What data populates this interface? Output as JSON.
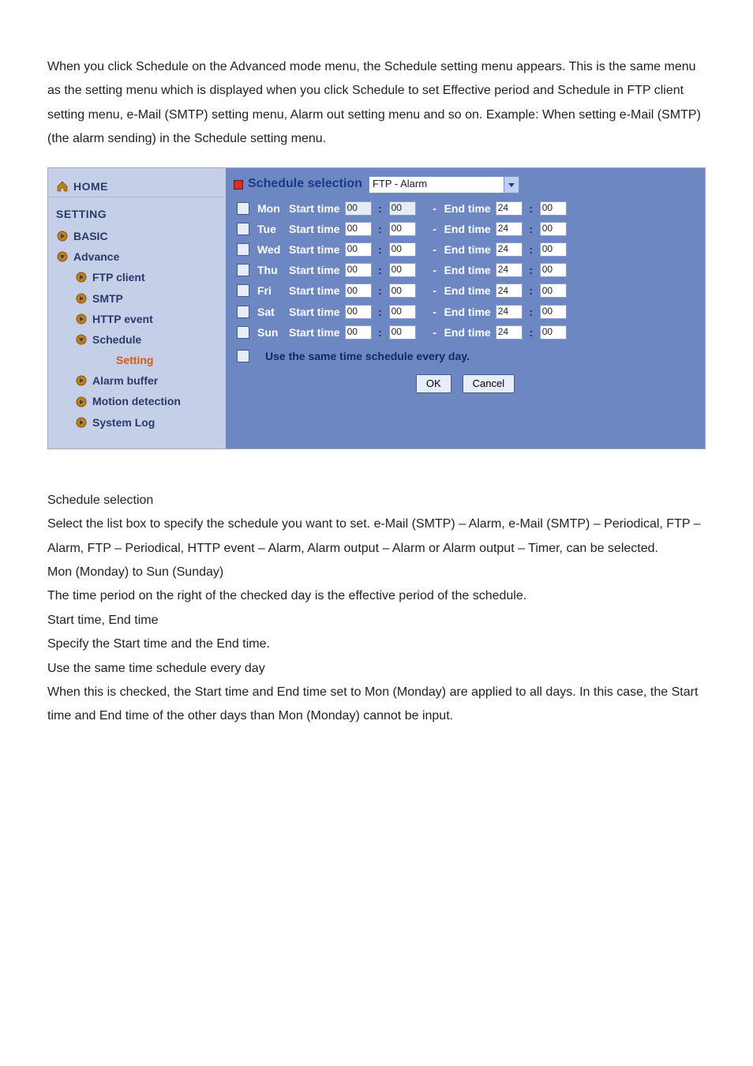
{
  "intro": "When you click Schedule on the Advanced mode menu, the Schedule setting menu appears. This is the same menu as the setting menu which is displayed when you click Schedule to set Effective period and Schedule in FTP client setting menu, e-Mail (SMTP) setting menu, Alarm out setting menu and so on. Example: When setting e-Mail (SMTP) (the alarm sending) in the Schedule setting menu.",
  "sidebar": {
    "home": "HOME",
    "setting_head": "SETTING",
    "basic": "BASIC",
    "advance": "Advance",
    "ftp": "FTP client",
    "smtp": "SMTP",
    "http": "HTTP event",
    "schedule": "Schedule",
    "setting": "Setting",
    "alarm": "Alarm buffer",
    "motion": "Motion detection",
    "syslog": "System Log"
  },
  "panel": {
    "title": "Schedule selection",
    "select_value": "FTP - Alarm",
    "days": [
      {
        "day": "Mon",
        "sh": "00",
        "sm": "00",
        "eh": "24",
        "em": "00",
        "firstRO": true
      },
      {
        "day": "Tue",
        "sh": "00",
        "sm": "00",
        "eh": "24",
        "em": "00",
        "firstRO": false
      },
      {
        "day": "Wed",
        "sh": "00",
        "sm": "00",
        "eh": "24",
        "em": "00",
        "firstRO": false
      },
      {
        "day": "Thu",
        "sh": "00",
        "sm": "00",
        "eh": "24",
        "em": "00",
        "firstRO": false
      },
      {
        "day": "Fri",
        "sh": "00",
        "sm": "00",
        "eh": "24",
        "em": "00",
        "firstRO": false
      },
      {
        "day": "Sat",
        "sh": "00",
        "sm": "00",
        "eh": "24",
        "em": "00",
        "firstRO": false
      },
      {
        "day": "Sun",
        "sh": "00",
        "sm": "00",
        "eh": "24",
        "em": "00",
        "firstRO": false
      }
    ],
    "start_label": "Start time",
    "end_label": "End time",
    "use_same": "Use the same time schedule every day.",
    "ok": "OK",
    "cancel": "Cancel"
  },
  "after": {
    "h1": "Schedule selection",
    "p1": "Select the list box to specify the schedule you want to set. e-Mail (SMTP) – Alarm, e-Mail (SMTP) – Periodical, FTP – Alarm, FTP – Periodical, HTTP event – Alarm, Alarm output – Alarm or Alarm output – Timer, can be selected.",
    "h2": "Mon (Monday) to Sun (Sunday)",
    "p2": "The time period on the right of the checked day is the effective period of the schedule.",
    "h3": "Start time, End time",
    "p3": "Specify the Start time and the End time.",
    "h4": "Use the same time schedule every day",
    "p4": "When this is checked, the Start time and End time set to Mon (Monday) are applied to all days. In this case,   the Start time and End time of the other days than Mon (Monday) cannot be input."
  }
}
